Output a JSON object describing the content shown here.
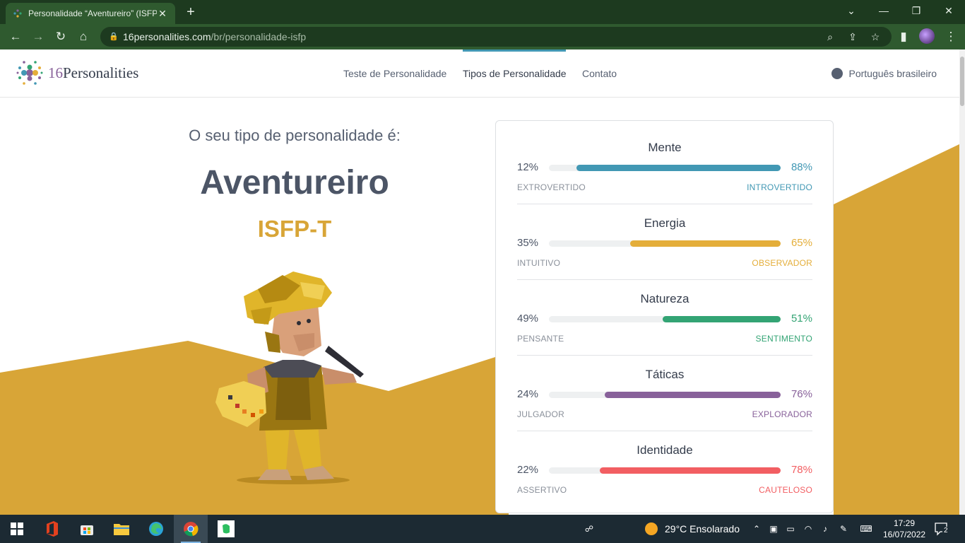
{
  "browser": {
    "tab_title": "Personalidade “Aventureiro” (ISFP",
    "url_host": "16personalities.com",
    "url_path": "/br/personalidade-isfp"
  },
  "site": {
    "logo_number": "16",
    "logo_word": "Personalities",
    "nav": [
      {
        "label": "Teste de Personalidade"
      },
      {
        "label": "Tipos de Personalidade"
      },
      {
        "label": "Contato"
      }
    ],
    "active_nav": "Tipos de Personalidade",
    "language": "Português brasileiro"
  },
  "result": {
    "intro": "O seu tipo de personalidade é:",
    "type_name": "Aventureiro",
    "type_code": "ISFP-T"
  },
  "traits": [
    {
      "title": "Mente",
      "left_pct": "12%",
      "right_pct": "88%",
      "left_name": "EXTROVERTIDO",
      "right_name": "INTROVERTIDO",
      "fill": 0.88,
      "color": "#4298b4"
    },
    {
      "title": "Energia",
      "left_pct": "35%",
      "right_pct": "65%",
      "left_name": "INTUITIVO",
      "right_name": "OBSERVADOR",
      "fill": 0.65,
      "color": "#e4ae3a"
    },
    {
      "title": "Natureza",
      "left_pct": "49%",
      "right_pct": "51%",
      "left_name": "PENSANTE",
      "right_name": "SENTIMENTO",
      "fill": 0.51,
      "color": "#33a474"
    },
    {
      "title": "Táticas",
      "left_pct": "24%",
      "right_pct": "76%",
      "left_name": "JULGADOR",
      "right_name": "EXPLORADOR",
      "fill": 0.76,
      "color": "#88619a"
    },
    {
      "title": "Identidade",
      "left_pct": "22%",
      "right_pct": "78%",
      "left_name": "ASSERTIVO",
      "right_name": "CAUTELOSO",
      "fill": 0.78,
      "color": "#f25e62"
    }
  ],
  "taskbar": {
    "weather": "29°C  Ensolarado",
    "time": "17:29",
    "date": "16/07/2022",
    "notifications": "2"
  },
  "colors": {
    "accent_gold": "#d8a537",
    "chrome_dark": "#1d3a1f",
    "chrome_mid": "#2f5a2f"
  }
}
